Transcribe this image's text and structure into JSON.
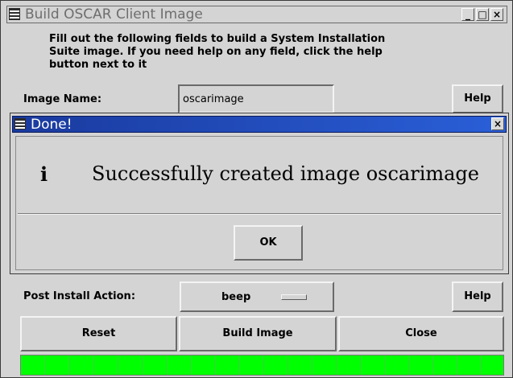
{
  "main_window": {
    "title": "Build OSCAR Client Image",
    "instructions": "Fill out the following fields to build a System Installation\nSuite image.  If you need help on any field, click the help\nbutton next to it",
    "image_name_label": "Image Name:",
    "image_name_value": "oscarimage",
    "help_label": "Help",
    "post_install_label": "Post Install Action:",
    "post_install_value": "beep",
    "buttons": {
      "reset": "Reset",
      "build": "Build Image",
      "close": "Close"
    },
    "progress": 1.0,
    "progress_color": "#00ff00"
  },
  "dialog": {
    "title": "Done!",
    "icon": "i",
    "message": "Successfully created image oscarimage",
    "ok_label": "OK",
    "title_color": "#1a3a9e"
  },
  "window_controls": {
    "minimize": "_",
    "maximize": "□",
    "close": "×"
  }
}
